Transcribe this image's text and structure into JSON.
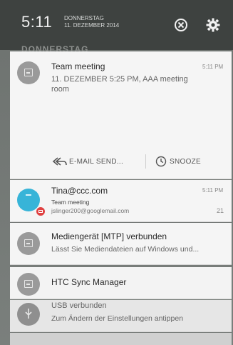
{
  "status": {
    "time": "5:11",
    "day": "DONNERSTAG",
    "date": "11. DEZEMBER 2014",
    "ghost_text": "DONNERSTAG"
  },
  "notifications": [
    {
      "title": "Team meeting",
      "time": "5:11 PM",
      "body_line1": "11. DEZEMBER 5:25 PM, AAA meeting",
      "body_line2": "room",
      "actions": [
        {
          "label": "E-MAIL SEND...",
          "icon": "reply-all-icon"
        },
        {
          "label": "SNOOZE",
          "icon": "clock-icon"
        }
      ]
    },
    {
      "title": "Tina@ccc.com",
      "time": "5:11 PM",
      "line2": "Team meeting",
      "line3": "jslinger200@googlemail.com",
      "count": "21"
    },
    {
      "title": "Mediengerät [MTP] verbunden",
      "body": "Lässt Sie Mediendateien auf Windows und..."
    },
    {
      "title": "HTC Sync Manager"
    },
    {
      "title": "USB verbunden",
      "body": "Zum Ändern der Einstellungen antippen"
    }
  ],
  "colors": {
    "header": "#3e4240",
    "card": "#f5f5f5",
    "avatar": "#37b4d8",
    "badge": "#e04242"
  }
}
